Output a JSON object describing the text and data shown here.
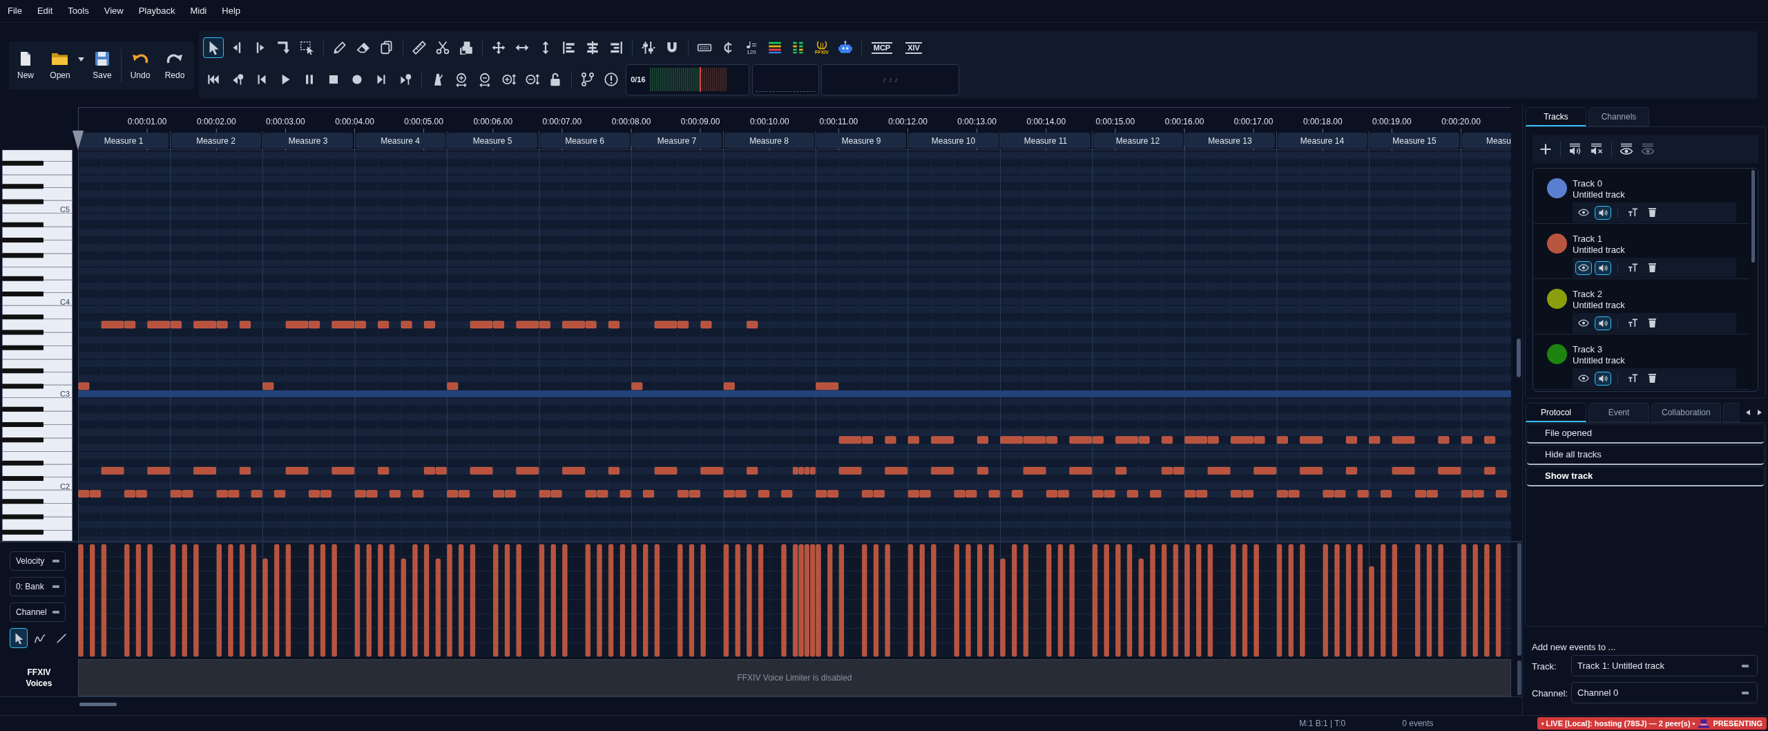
{
  "menu": [
    "File",
    "Edit",
    "Tools",
    "View",
    "Playback",
    "Midi",
    "Help"
  ],
  "file_buttons": [
    {
      "label": "New",
      "dropdown": false
    },
    {
      "label": "Open",
      "dropdown": true
    },
    {
      "label": "Save",
      "dropdown": false
    },
    {
      "label": "Undo",
      "dropdown": false
    },
    {
      "label": "Redo",
      "dropdown": false
    }
  ],
  "tools": [
    {
      "selected": true
    },
    {
      "selected": false
    },
    {
      "selected": false
    },
    {
      "selected": false
    },
    {
      "selected": false
    }
  ],
  "tempo_button": {
    "text": "120"
  },
  "lyre_button": {
    "text": "FFXIV"
  },
  "text_badges": [
    "MCP",
    "XIV"
  ],
  "displays": {
    "voice_count": "0/16",
    "notes": "♪ ♪ ♪"
  },
  "timeline": {
    "times": [
      "0:00:01.00",
      "0:00:02.00",
      "0:00:03.00",
      "0:00:04.00",
      "0:00:05.00",
      "0:00:06.00",
      "0:00:07.00",
      "0:00:08.00",
      "0:00:09.00",
      "0:00:10.00",
      "0:00:11.00",
      "0:00:12.00",
      "0:00:13.00",
      "0:00:14.00",
      "0:00:15.00",
      "0:00:16.00",
      "0:00:17.00",
      "0:00:18.00",
      "0:00:19.00",
      "0:00:20.00"
    ],
    "measures": [
      "Measure 1",
      "Measure 2",
      "Measure 3",
      "Measure 4",
      "Measure 5",
      "Measure 6",
      "Measure 7",
      "Measure 8",
      "Measure 9",
      "Measure 10",
      "Measure 11",
      "Measure 12",
      "Measure 13",
      "Measure 14",
      "Measure 15",
      "Measu"
    ]
  },
  "piano": {
    "keys": [
      {
        "label": "C5",
        "selected": false
      },
      {
        "label": "C4",
        "selected": false
      },
      {
        "label": "C3",
        "selected": true
      },
      {
        "label": "C2",
        "selected": false
      }
    ]
  },
  "lanes": {
    "dropdowns": [
      "Velocity",
      "0: Bank",
      "Channel"
    ],
    "tools": [
      {
        "selected": true
      },
      {
        "selected": false
      },
      {
        "selected": false
      }
    ]
  },
  "voices_lane": {
    "title": "FFXIV Voices",
    "message": "FFXIV Voice Limiter is disabled"
  },
  "panel_tabs": [
    {
      "label": "Tracks",
      "selected": true
    },
    {
      "label": "Channels",
      "selected": false
    }
  ],
  "tracks": [
    {
      "name": "Track 0",
      "title": "Untitled track",
      "color": "#5b7fd0",
      "view_on": false,
      "audio_on": true
    },
    {
      "name": "Track 1",
      "title": "Untitled track",
      "color": "#b8553f",
      "view_on": true,
      "audio_on": true
    },
    {
      "name": "Track 2",
      "title": "Untitled track",
      "color": "#8a9e0e",
      "view_on": false,
      "audio_on": true
    },
    {
      "name": "Track 3",
      "title": "Untitled track",
      "color": "#1d8410",
      "view_on": false,
      "audio_on": true
    }
  ],
  "lower_tabs": [
    {
      "label": "Protocol",
      "selected": true
    },
    {
      "label": "Event",
      "selected": false
    },
    {
      "label": "Collaboration",
      "selected": false
    }
  ],
  "history": [
    {
      "label": "File opened",
      "current": false
    },
    {
      "label": "Hide all tracks",
      "current": false
    },
    {
      "label": "Show track",
      "current": true
    }
  ],
  "add_events": {
    "heading": "Add new events to ...",
    "track_label": "Track:",
    "track_value": "Track 1: Untitled track",
    "channel_label": "Channel:",
    "channel_value": "Channel 0"
  },
  "status_bar": {
    "position": "M:1 B:1 | T:0",
    "events": "0 events",
    "live": "• LIVE [Local]: hosting (78SJ) — 2 peer(s) •",
    "mode": "PRESENTING"
  }
}
